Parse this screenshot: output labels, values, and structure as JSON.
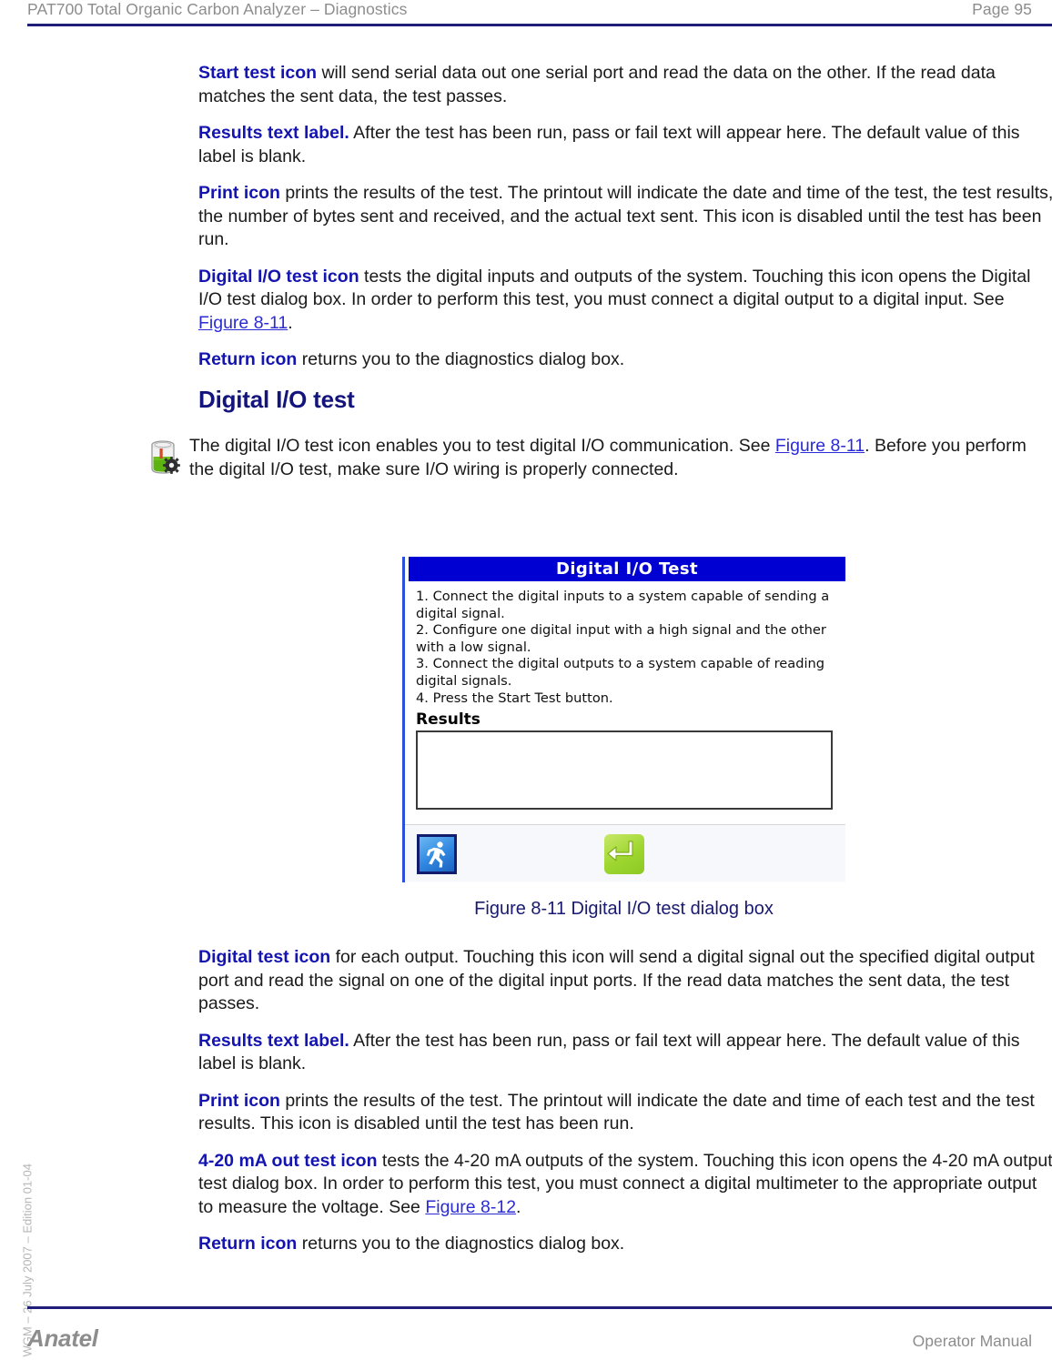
{
  "header": {
    "title": "PAT700 Total Organic Carbon Analyzer – Diagnostics",
    "page": "Page 95"
  },
  "footer": {
    "brand": "Anatel",
    "right": "Operator Manual",
    "side_note": "WGM – 26 July 2007 – Edition 01-04"
  },
  "body_top": {
    "paragraphs": [
      {
        "lead": "Start test icon",
        "text": " will send serial data out one serial port and read the data on the other. If the read data matches the sent data, the test passes."
      },
      {
        "lead": "Results text label.",
        "text": " After the test has been run, pass or fail text will appear here. The default value of this label is blank."
      },
      {
        "lead": "Print icon",
        "text": " prints the results of the test. The printout will indicate the date and time of the test, the test results, the number of bytes sent and received, and the actual text sent. This icon is disabled until the test has been run."
      },
      {
        "lead": "Digital I/O test icon",
        "text": " tests the digital inputs and outputs of the system. Touching this icon opens the Digital I/O test dialog box. In order to perform this test, you must connect a digital output to a digital input. See ",
        "xref": "Figure 8-11",
        "tail": "."
      },
      {
        "lead": "Return icon",
        "text": " returns you to the diagnostics dialog box."
      }
    ]
  },
  "section": {
    "heading": "Digital I/O test",
    "note_icon": "beaker-gear-icon",
    "note_text_before": "The digital I/O test icon enables you to test digital I/O communication. See ",
    "note_xref": "Figure 8-11",
    "note_text_after": ". Before you perform the digital I/O test, make sure I/O wiring is properly connected."
  },
  "figure": {
    "caption": "Figure 8-11 Digital I/O test dialog box",
    "dialog": {
      "title": "Digital I/O Test",
      "steps": [
        "1. Connect the digital inputs to a system capable of sending a digital signal.",
        "2. Configure one digital input with a high signal and the other with a low signal.",
        "3. Connect the digital outputs to a system capable of reading digital signals.",
        "4. Press the Start Test button."
      ],
      "results_label": "Results",
      "results_value": "",
      "buttons": [
        {
          "name": "start-test-button",
          "icon": "running-person-icon"
        },
        {
          "name": "return-button",
          "icon": "return-arrow-icon"
        }
      ]
    }
  },
  "body_bottom": {
    "paragraphs": [
      {
        "lead": "Digital test icon",
        "text": " for each output. Touching this icon will send a digital signal out the specified digital output port and read the signal on one of the digital input ports. If the read data matches the sent data, the test passes."
      },
      {
        "lead": "Results text label.",
        "text": " After the test has been run, pass or fail text will appear here. The default value of this label is blank."
      },
      {
        "lead": "Print icon",
        "text": " prints the results of the test. The printout will indicate the date and time of each test and the test results. This icon is disabled until the test has been run."
      },
      {
        "lead": "4-20 mA out test icon",
        "text": " tests the 4-20 mA outputs of the system. Touching this icon opens the 4-20 mA output test dialog box. In order to perform this test, you must connect a digital multimeter to the appropriate output to measure the voltage. See ",
        "xref": "Figure 8-12",
        "tail": "."
      },
      {
        "lead": "Return icon",
        "text": " returns you to the diagnostics dialog box."
      }
    ]
  },
  "colors": {
    "rule": "#1f1f7a",
    "lead": "#1414b0",
    "xref": "#2b2bd4",
    "heading": "#14147d",
    "caption": "#191970",
    "dialog_title_bg": "#0000d2"
  }
}
